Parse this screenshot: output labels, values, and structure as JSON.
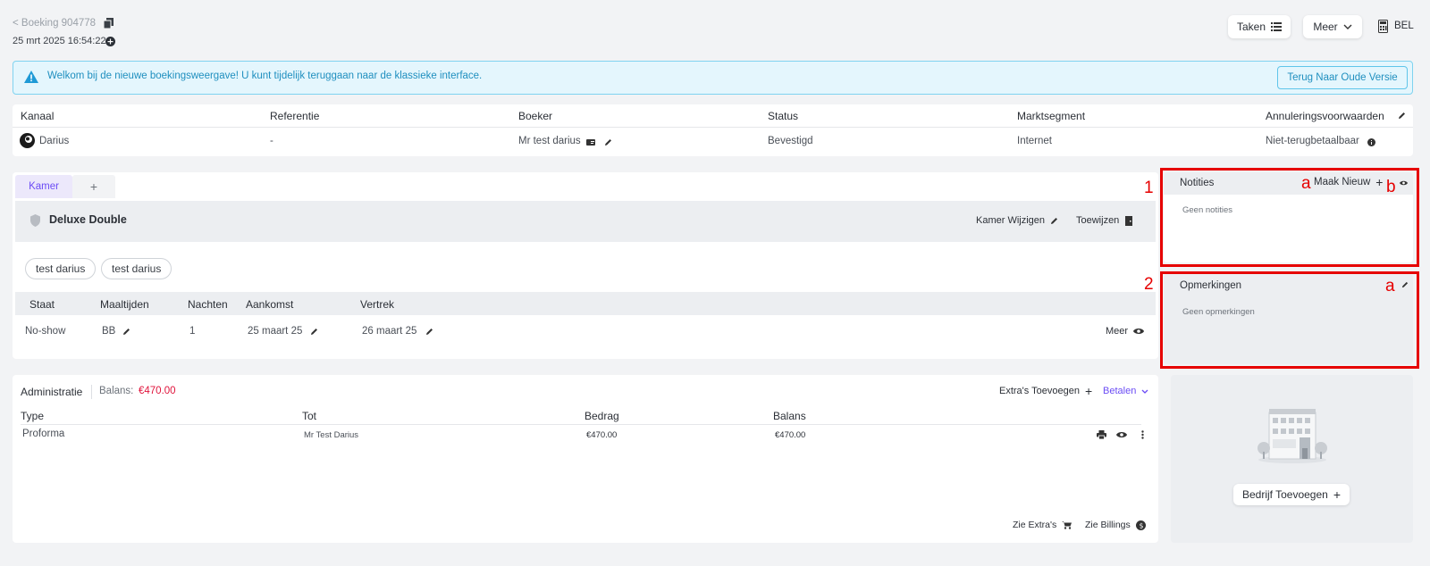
{
  "header": {
    "back_link": "< Boeking 904778",
    "datetime": "25 mrt 2025 16:54:22",
    "taken_label": "Taken",
    "meer_label": "Meer",
    "bel_label": "BEL"
  },
  "banner": {
    "message": "Welkom bij de nieuwe boekingsweergave! U kunt tijdelijk teruggaan naar de klassieke interface.",
    "button_label": "Terug Naar Oude Versie"
  },
  "booking_info": {
    "headers": [
      "Kanaal",
      "Referentie",
      "Boeker",
      "Status",
      "Marktsegment",
      "Annuleringsvoorwaarden"
    ],
    "values": [
      "Darius",
      "-",
      "Mr test darius",
      "Bevestigd",
      "Internet",
      "Niet-terugbetaalbaar"
    ]
  },
  "room": {
    "tab_label": "Kamer",
    "tab_add": "+",
    "room_name": "Deluxe Double",
    "change_label": "Kamer Wijzigen",
    "assign_label": "Toewijzen",
    "guests": [
      "test darius",
      "test darius"
    ],
    "table_headers": [
      "Staat",
      "Maaltijden",
      "Nachten",
      "Aankomst",
      "Vertrek"
    ],
    "row": {
      "staat": "No-show",
      "maaltijden": "BB",
      "nachten": "1",
      "aankomst": "25 maart 25",
      "vertrek": "26 maart 25",
      "meer": "Meer"
    }
  },
  "administration": {
    "title": "Administratie",
    "balance_label": "Balans:",
    "balance_value": "€470.00",
    "extras_label": "Extra's Toevoegen",
    "pay_label": "Betalen",
    "headers": [
      "Type",
      "Tot",
      "Bedrag",
      "Balans"
    ],
    "rows": [
      {
        "type": "Proforma",
        "tot": "Mr Test Darius",
        "bedrag": "€470.00",
        "balans": "€470.00"
      }
    ],
    "see_extras": "Zie Extra's",
    "see_billings": "Zie Billings"
  },
  "notes": {
    "title": "Notities",
    "new_label": "Maak Nieuw",
    "empty": "Geen notities"
  },
  "remarks": {
    "title": "Opmerkingen",
    "empty": "Geen opmerkingen"
  },
  "company": {
    "add_label": "Bedrijf Toevoegen"
  },
  "annotations": {
    "n1": "1",
    "n2": "2",
    "a1": "a",
    "b1": "b",
    "a2": "a"
  },
  "colors": {
    "accent": "#6b4cf5",
    "banner_bg": "#e4f6fd",
    "banner_border": "#7fd3f0",
    "banner_text": "#1f8fbf",
    "balance_red": "#e0143c",
    "annotation_red": "#e60000"
  }
}
